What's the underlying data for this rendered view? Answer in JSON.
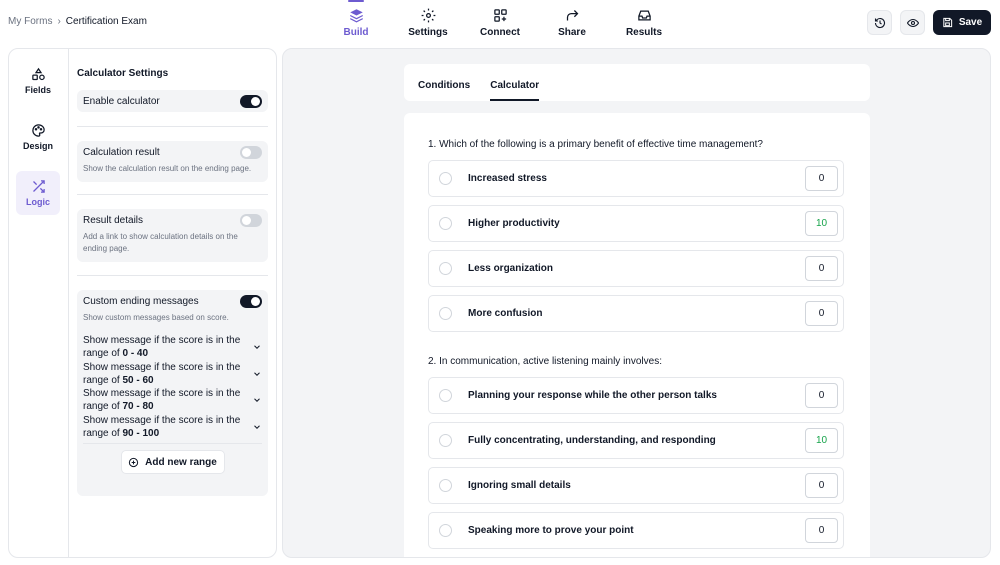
{
  "breadcrumb": {
    "root": "My Forms",
    "separator": "›",
    "current": "Certification Exam"
  },
  "nav": [
    {
      "label": "Build",
      "icon": "layers-icon",
      "active": true
    },
    {
      "label": "Settings",
      "icon": "gear-icon",
      "active": false
    },
    {
      "label": "Connect",
      "icon": "grid-plus-icon",
      "active": false
    },
    {
      "label": "Share",
      "icon": "share-arrow-icon",
      "active": false
    },
    {
      "label": "Results",
      "icon": "inbox-icon",
      "active": false
    }
  ],
  "actions": {
    "history_icon": "history-icon",
    "preview_icon": "eye-icon",
    "save_label": "Save"
  },
  "rail": [
    {
      "label": "Fields",
      "icon": "shapes-icon"
    },
    {
      "label": "Design",
      "icon": "palette-icon"
    },
    {
      "label": "Logic",
      "icon": "shuffle-icon",
      "active": true
    }
  ],
  "calculator_settings": {
    "title": "Calculator Settings",
    "enable_calculator": {
      "label": "Enable calculator",
      "on": true
    },
    "calculation_result": {
      "label": "Calculation result",
      "desc": "Show the calculation result on the ending page.",
      "on": false
    },
    "result_details": {
      "label": "Result details",
      "desc": "Add a link to show calculation details on the ending page.",
      "on": false
    },
    "custom_ending": {
      "label": "Custom ending messages",
      "desc": "Show custom messages based on score.",
      "on": true
    },
    "range_prefix": "Show message if the score is in the range of",
    "ranges": [
      "0 - 40",
      "50 - 60",
      "70 - 80",
      "90 - 100"
    ],
    "add_range_label": "Add new range"
  },
  "tabs": [
    {
      "label": "Conditions",
      "active": false
    },
    {
      "label": "Calculator",
      "active": true
    }
  ],
  "questions": [
    {
      "text": "1.  Which of the following is a primary benefit of effective time management?",
      "options": [
        {
          "text": "Increased stress",
          "score": "0"
        },
        {
          "text": "Higher productivity",
          "score": "10"
        },
        {
          "text": "Less organization",
          "score": "0"
        },
        {
          "text": "More confusion",
          "score": "0"
        }
      ]
    },
    {
      "text": "2.  In communication, active listening mainly involves:",
      "options": [
        {
          "text": "Planning your response while the other person talks",
          "score": "0"
        },
        {
          "text": "Fully concentrating, understanding, and responding",
          "score": "10"
        },
        {
          "text": "Ignoring small details",
          "score": "0"
        },
        {
          "text": "Speaking more to prove your point",
          "score": "0"
        }
      ]
    }
  ],
  "colors": {
    "accent": "#6d5bd0",
    "positive_score": "#16a34a",
    "dark": "#111827"
  }
}
